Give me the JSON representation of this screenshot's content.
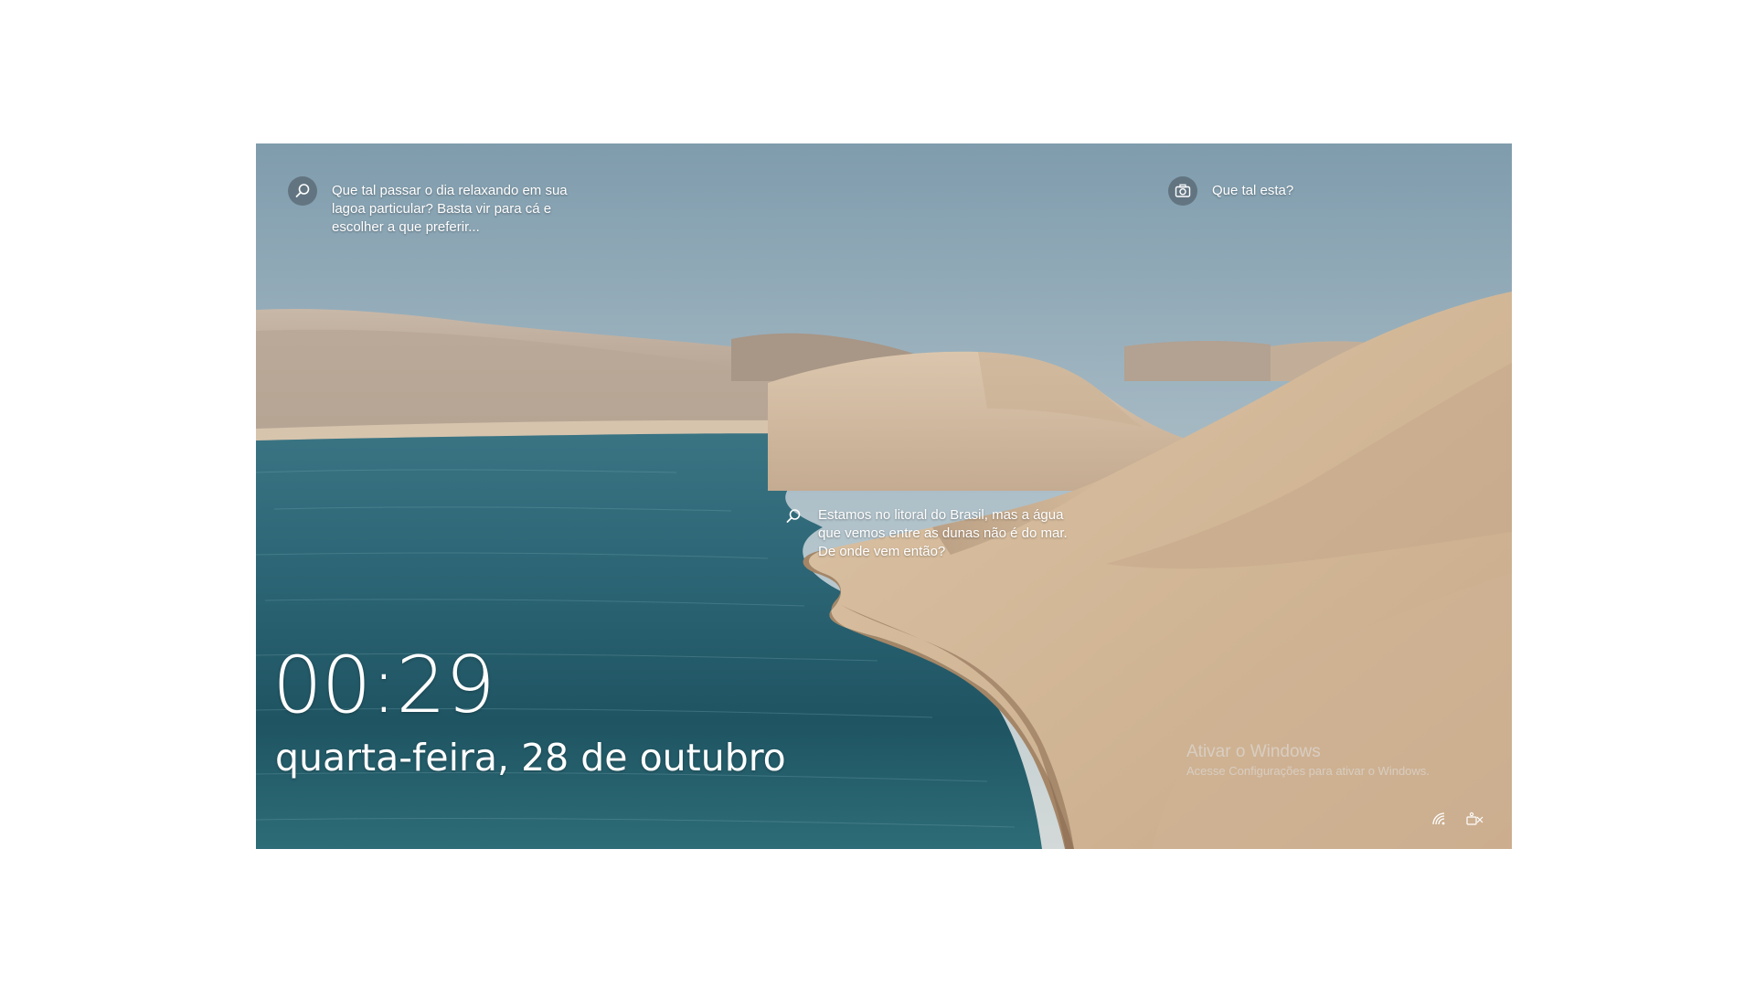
{
  "lock_screen": {
    "hints": {
      "top_left": {
        "icon": "search-icon",
        "text": "Que tal passar o dia relaxando em sua lagoa particular? Basta vir para cá e escolher a que preferir..."
      },
      "top_right": {
        "icon": "camera-icon",
        "text": "Que tal esta?"
      },
      "middle": {
        "icon": "search-icon",
        "text": "Estamos no litoral do Brasil, mas a água que vemos entre as dunas não é do mar. De onde vem então?"
      }
    },
    "time": "00:29",
    "date": "quarta-feira, 28 de outubro",
    "watermark": {
      "title": "Ativar o Windows",
      "subtitle": "Acesse Configurações para ativar o Windows."
    },
    "status_icons": [
      "wifi-icon",
      "accessibility-icon"
    ]
  },
  "colors": {
    "sky_top": "#7d9aab",
    "sky_bottom": "#c9d3d6",
    "water_dark": "#1e4d5c",
    "water_light": "#4d8493",
    "sand_light": "#e2cdb3",
    "sand_shadow": "#b69a80",
    "text": "#ffffff"
  }
}
